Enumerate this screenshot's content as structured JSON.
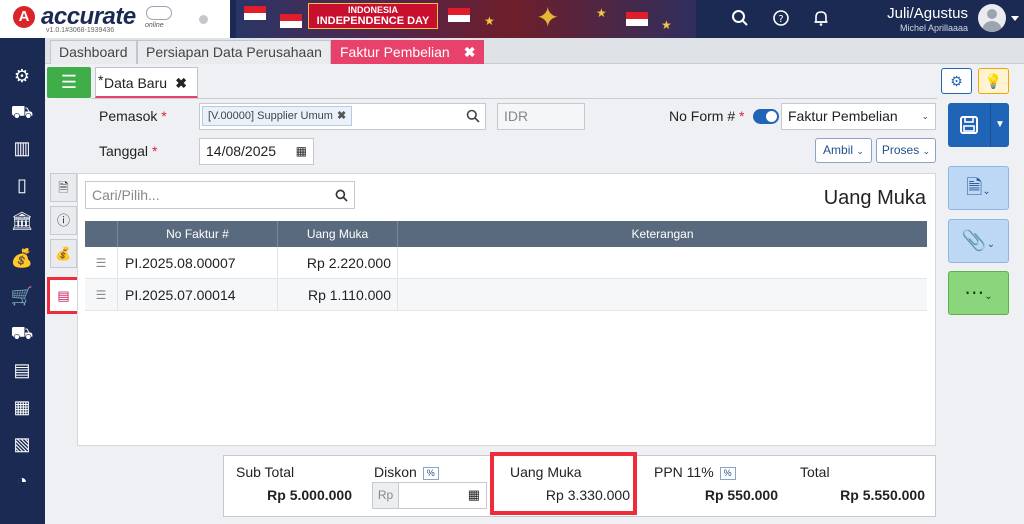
{
  "app": {
    "logo_letter": "A",
    "logo_name": "accurate",
    "logo_sub": "online",
    "version": "v1.0.1#3068-1939436",
    "banner": {
      "line1": "INDONESIA",
      "line2": "INDEPENDENCE DAY"
    }
  },
  "header": {
    "user_name": "Juli/Agustus",
    "user_sub": "Michel Aprillaaaa",
    "icons": [
      "search-icon",
      "help-icon",
      "bell-icon"
    ]
  },
  "sidebar": {
    "icons": [
      "settings-icon",
      "inventory-icon",
      "company-icon",
      "mobile-icon",
      "bank-icon",
      "money-bag-icon",
      "cart-icon",
      "delivery-icon",
      "warehouse-icon",
      "production-icon",
      "tax-icon",
      "report-icon"
    ]
  },
  "tabs": {
    "items": [
      {
        "label": "Dashboard"
      },
      {
        "label": "Persiapan Data Perusahaan"
      },
      {
        "label": "Faktur Pembelian",
        "close": "✖"
      }
    ],
    "count": "3"
  },
  "subtab": {
    "label": "Data Baru",
    "mark": "*",
    "close": "✖"
  },
  "form": {
    "pemasok_label": "Pemasok",
    "required": "*",
    "pemasok_value": "[V.00000] Supplier Umum",
    "currency": "IDR",
    "tanggal_label": "Tanggal",
    "tanggal_value": "14/08/2025",
    "no_form_label": "No Form #",
    "no_form_value": "Faktur Pembelian",
    "ambil_label": "Ambil",
    "proses_label": "Proses"
  },
  "panel": {
    "search_placeholder": "Cari/Pilih...",
    "title": "Uang Muka",
    "columns": [
      "No Faktur #",
      "Uang Muka",
      "Keterangan"
    ],
    "rows": [
      {
        "no_faktur": "PI.2025.08.00007",
        "uang_muka": "Rp 2.220.000",
        "keterangan": ""
      },
      {
        "no_faktur": "PI.2025.07.00014",
        "uang_muka": "Rp 1.110.000",
        "keterangan": ""
      }
    ]
  },
  "footer": {
    "sub_total_label": "Sub Total",
    "sub_total_value": "Rp 5.000.000",
    "diskon_label": "Diskon",
    "diskon_pct": "%",
    "diskon_prefix": "Rp",
    "uang_muka_label": "Uang Muka",
    "uang_muka_value": "Rp 3.330.000",
    "ppn_label": "PPN 11%",
    "ppn_pct": "%",
    "ppn_value": "Rp 550.000",
    "total_label": "Total",
    "total_value": "Rp 5.550.000"
  },
  "colors": {
    "navy": "#1b2a52",
    "accent_pink": "#e8426c",
    "primary_blue": "#1f64b7",
    "green": "#3fae49",
    "highlight_red": "#ee2c3b"
  }
}
